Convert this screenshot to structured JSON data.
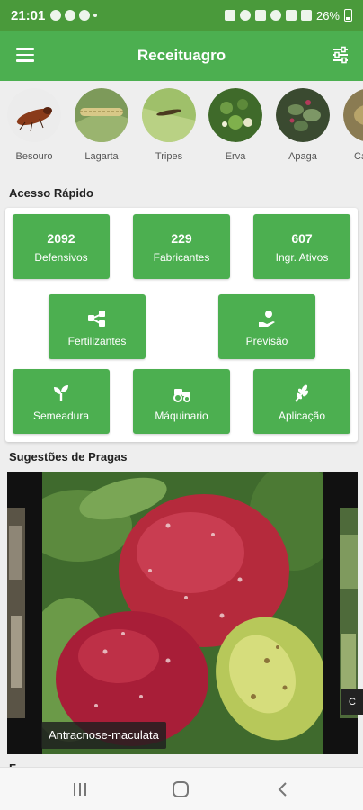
{
  "status": {
    "time": "21:01",
    "battery": "26%"
  },
  "header": {
    "title": "Receituagro",
    "menu_icon": "hamburger-menu-icon",
    "filter_icon": "sliders-icon"
  },
  "categories": [
    {
      "label": "Besouro"
    },
    {
      "label": "Lagarta"
    },
    {
      "label": "Tripes"
    },
    {
      "label": "Erva"
    },
    {
      "label": "Apaga"
    },
    {
      "label": "Ca"
    }
  ],
  "quick_access": {
    "title": "Acesso Rápido",
    "defensivos": {
      "value": "2092",
      "label": "Defensivos"
    },
    "fabricantes": {
      "value": "229",
      "label": "Fabricantes"
    },
    "ingredientes": {
      "value": "607",
      "label": "Ingr. Ativos"
    },
    "fertilizantes": {
      "label": "Fertilizantes"
    },
    "previsao": {
      "label": "Previsão"
    },
    "semeadura": {
      "label": "Semeadura"
    },
    "maquinario": {
      "label": "Máquinario"
    },
    "aplicacao": {
      "label": "Aplicação"
    }
  },
  "pests": {
    "title": "Sugestões de Pragas",
    "current": "Antracnose-maculata",
    "next_partial": "C"
  },
  "colors": {
    "primary": "#4caf50",
    "status_bar": "#4a9a3b"
  }
}
